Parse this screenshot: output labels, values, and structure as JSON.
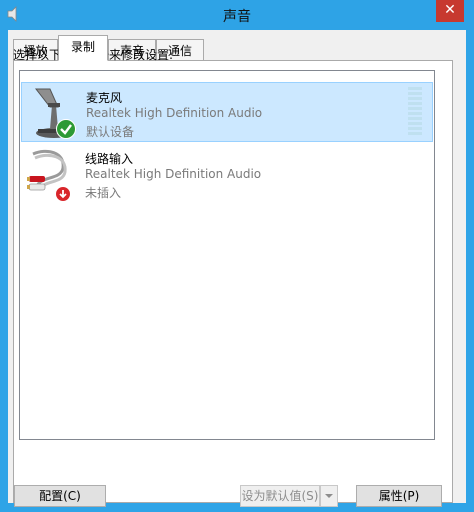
{
  "window": {
    "title": "声音",
    "close_glyph": "✕"
  },
  "tabs": [
    {
      "label": "播放"
    },
    {
      "label": "录制"
    },
    {
      "label": "声音"
    },
    {
      "label": "通信"
    }
  ],
  "recording": {
    "instruction": "选择以下录制设备来修改设置:",
    "devices": [
      {
        "name": "麦克风",
        "driver": "Realtek High Definition Audio",
        "status": "默认设备",
        "icon": "microphone-icon",
        "badge": "default-check-badge",
        "selected": true
      },
      {
        "name": "线路输入",
        "driver": "Realtek High Definition Audio",
        "status": "未插入",
        "icon": "line-in-cable-icon",
        "badge": "unplugged-badge",
        "selected": false
      }
    ]
  },
  "buttons": {
    "configure": "配置(C)",
    "set_default": "设为默认值(S)",
    "properties": "属性(P)"
  },
  "colors": {
    "titlebar": "#2ea3e6",
    "close": "#c7392f",
    "selection": "#cce8ff",
    "check_badge": "#2e9a35",
    "unplugged_badge": "#d9262b"
  }
}
